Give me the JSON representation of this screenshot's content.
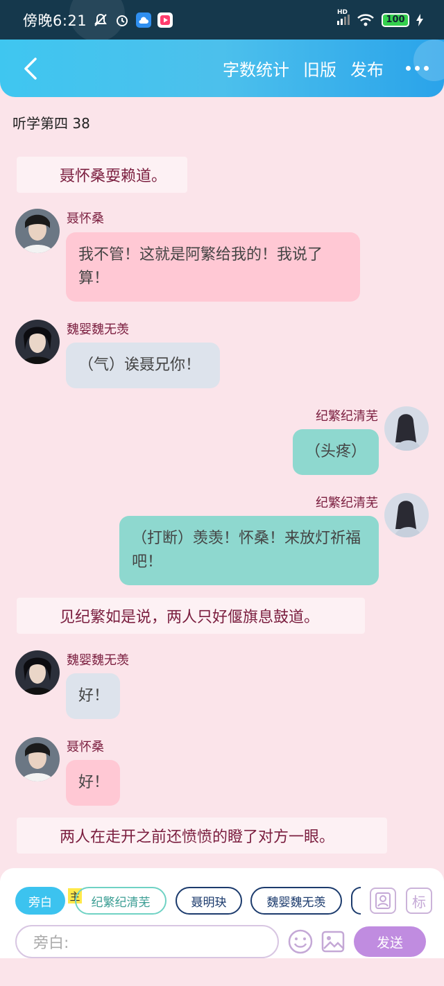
{
  "status_bar": {
    "time": "傍晚6:21",
    "battery": "100",
    "signal_label": "HD"
  },
  "header": {
    "actions": [
      "字数统计",
      "旧版",
      "发布"
    ]
  },
  "subtitle": "听学第四 38",
  "messages": [
    {
      "type": "narration",
      "text": "聂怀桑耍赖道。"
    },
    {
      "type": "message",
      "speaker": "聂怀桑",
      "text": "我不管！这就是阿繁给我的！我说了算！"
    },
    {
      "type": "message",
      "speaker": "魏婴魏无羡",
      "text": "（气）诶聂兄你！"
    },
    {
      "type": "message",
      "speaker": "纪繁纪清芜",
      "text": "（头疼）"
    },
    {
      "type": "message",
      "speaker": "纪繁纪清芜",
      "text": "（打断）羡羡！怀桑！来放灯祈福吧！"
    },
    {
      "type": "narration",
      "text": "见纪繁如是说，两人只好偃旗息鼓道。"
    },
    {
      "type": "message",
      "speaker": "魏婴魏无羡",
      "text": "好！"
    },
    {
      "type": "message",
      "speaker": "聂怀桑",
      "text": "好！"
    },
    {
      "type": "narration",
      "text": "两人在走开之前还愤愤的瞪了对方一眼。"
    }
  ],
  "composer": {
    "roles": [
      "旁白",
      "纪繁纪清芜",
      "聂明玦",
      "魏婴魏无羡"
    ],
    "main_badge": "主",
    "mark_button": "标",
    "placeholder": "旁白:",
    "send_label": "发送"
  },
  "colors": {
    "header_accent": "#3fc6f0",
    "background": "#fbe4ea",
    "send_button": "#c08ce0"
  }
}
